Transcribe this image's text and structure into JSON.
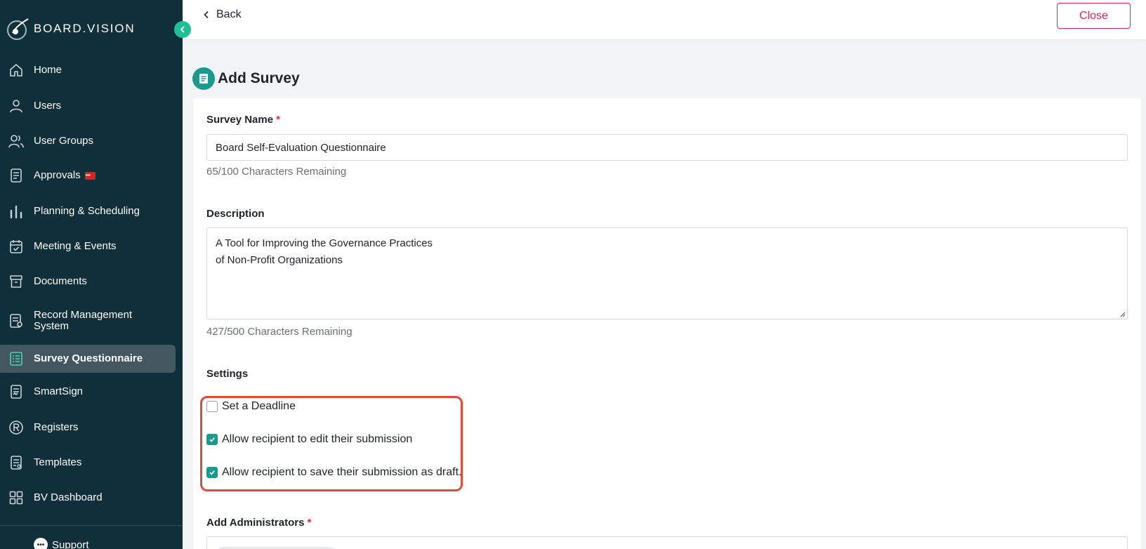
{
  "sidebar": {
    "brand": "BOARD.VISION",
    "items": [
      {
        "label": "Home",
        "icon": "home-icon"
      },
      {
        "label": "Users",
        "icon": "user-icon"
      },
      {
        "label": "User Groups",
        "icon": "user-group-icon"
      },
      {
        "label": "Approvals",
        "icon": "approvals-icon"
      },
      {
        "label": "Planning & Scheduling",
        "icon": "bar-chart-icon"
      },
      {
        "label": "Meeting & Events",
        "icon": "calendar-check-icon"
      },
      {
        "label": "Documents",
        "icon": "archive-box-icon"
      },
      {
        "label": "Record Management",
        "label2": "System",
        "icon": "record-document-icon"
      },
      {
        "label": "Survey Questionnaire",
        "icon": "survey-list-icon",
        "active": true
      },
      {
        "label": "SmartSign",
        "icon": "smartsign-document-icon"
      },
      {
        "label": "Registers",
        "icon": "registered-r-icon"
      },
      {
        "label": "Templates",
        "icon": "template-document-icon"
      },
      {
        "label": "BV Dashboard",
        "icon": "grid-dashboard-icon"
      }
    ],
    "support": "Support"
  },
  "topbar": {
    "back_label": "Back",
    "close_label": "Close"
  },
  "page": {
    "title": "Add Survey"
  },
  "form": {
    "survey_name_label": "Survey Name",
    "required_mark": "*",
    "survey_name_value": "Board Self-Evaluation Questionnaire",
    "survey_name_counter": "65/100 Characters Remaining",
    "description_label": "Description",
    "description_line1": "A Tool for Improving the Governance Practices",
    "description_line2": "of Non-Profit Organizations",
    "description_counter": "427/500 Characters Remaining",
    "settings_label": "Settings",
    "settings": [
      {
        "label": "Set a Deadline",
        "checked": false
      },
      {
        "label": "Allow recipient to edit their submission",
        "checked": true
      },
      {
        "label": "Allow recipient to save their submission as draft.",
        "checked": true
      }
    ],
    "administrators_label": "Add Administrators"
  },
  "colors": {
    "sidebar_bg": "#0f2f3a",
    "active_item_bg": "#42575f",
    "accent_teal": "#1a9a8c",
    "close_pink": "#e0245e",
    "highlight_red": "#e04a3a"
  }
}
